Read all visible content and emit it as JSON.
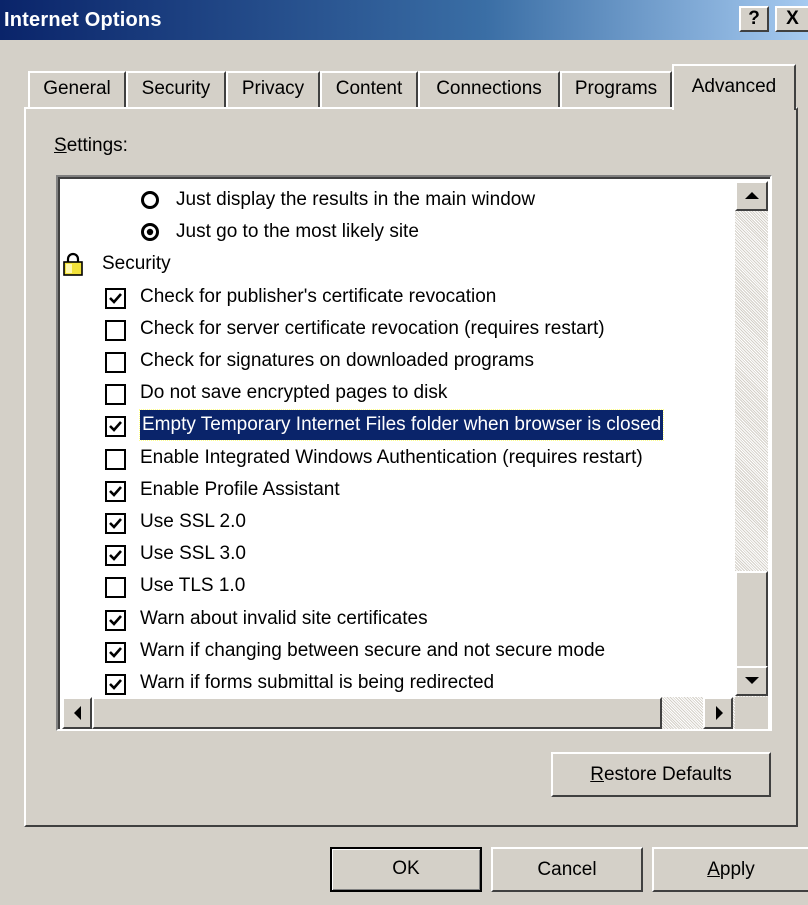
{
  "window": {
    "title": "Internet Options",
    "help_button": "?",
    "close_button": "X"
  },
  "tabs": [
    {
      "label": "General",
      "active": false
    },
    {
      "label": "Security",
      "active": false
    },
    {
      "label": "Privacy",
      "active": false
    },
    {
      "label": "Content",
      "active": false
    },
    {
      "label": "Connections",
      "active": false
    },
    {
      "label": "Programs",
      "active": false
    },
    {
      "label": "Advanced",
      "active": true
    }
  ],
  "settings": {
    "label_mnemonic": "S",
    "label_rest": "ettings:",
    "items": [
      {
        "type": "radio",
        "checked": false,
        "label": "Just display the results in the main window"
      },
      {
        "type": "radio",
        "checked": true,
        "label": "Just go to the most likely site"
      },
      {
        "type": "category",
        "icon": "lock-icon",
        "label": "Security"
      },
      {
        "type": "checkbox",
        "checked": true,
        "label": "Check for publisher's certificate revocation"
      },
      {
        "type": "checkbox",
        "checked": false,
        "label": "Check for server certificate revocation (requires restart)"
      },
      {
        "type": "checkbox",
        "checked": false,
        "label": "Check for signatures on downloaded programs"
      },
      {
        "type": "checkbox",
        "checked": false,
        "label": "Do not save encrypted pages to disk"
      },
      {
        "type": "checkbox",
        "checked": true,
        "label": "Empty Temporary Internet Files folder when browser is closed",
        "selected": true
      },
      {
        "type": "checkbox",
        "checked": false,
        "label": "Enable Integrated Windows Authentication (requires restart)"
      },
      {
        "type": "checkbox",
        "checked": true,
        "label": "Enable Profile Assistant"
      },
      {
        "type": "checkbox",
        "checked": true,
        "label": "Use SSL 2.0"
      },
      {
        "type": "checkbox",
        "checked": true,
        "label": "Use SSL 3.0"
      },
      {
        "type": "checkbox",
        "checked": false,
        "label": "Use TLS 1.0"
      },
      {
        "type": "checkbox",
        "checked": true,
        "label": "Warn about invalid site certificates"
      },
      {
        "type": "checkbox",
        "checked": true,
        "label": "Warn if changing between secure and not secure mode"
      },
      {
        "type": "checkbox",
        "checked": true,
        "label": "Warn if forms submittal is being redirected"
      }
    ]
  },
  "buttons": {
    "restore_mnemonic": "R",
    "restore_rest": "estore Defaults",
    "ok": "OK",
    "cancel": "Cancel",
    "apply_mnemonic": "A",
    "apply_rest": "pply"
  }
}
